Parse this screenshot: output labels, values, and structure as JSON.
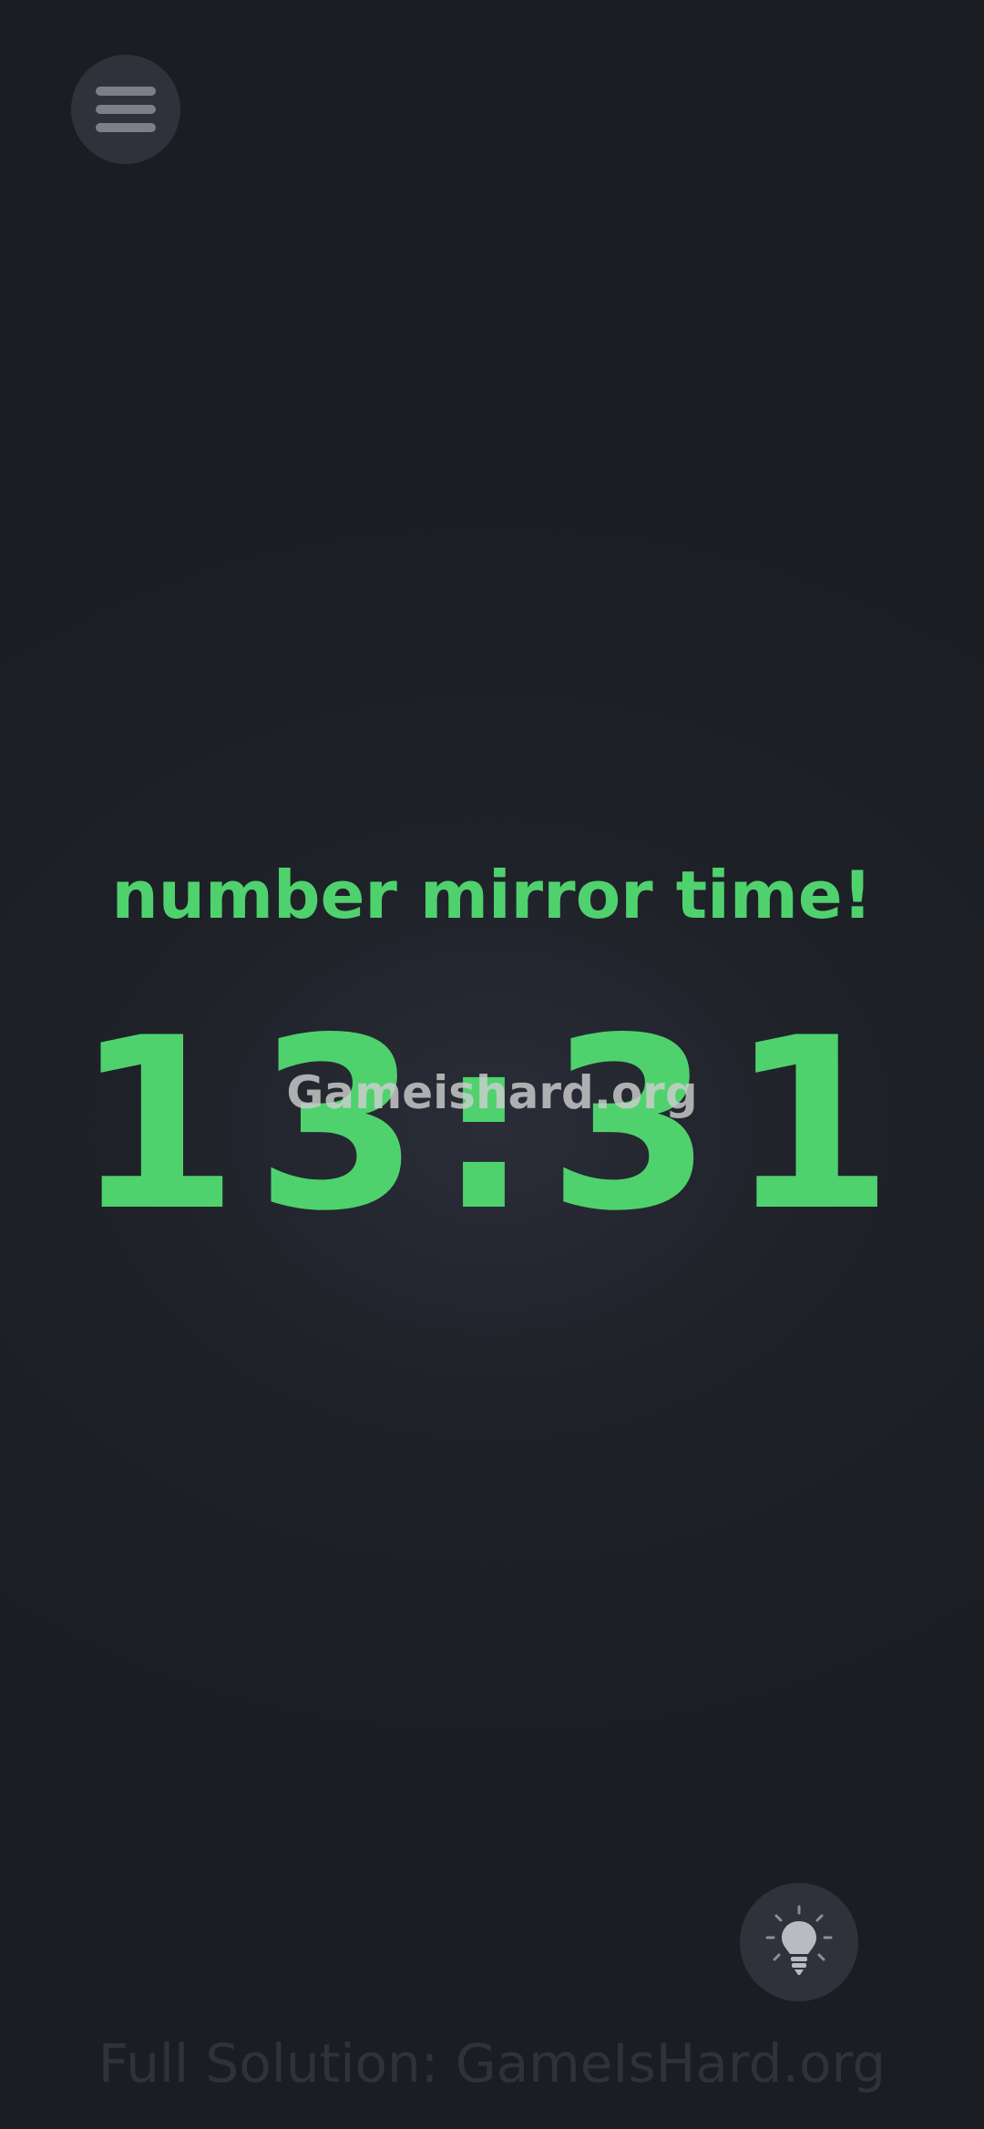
{
  "header": {
    "menu_icon": "hamburger-menu-icon"
  },
  "level": {
    "subtitle": "number mirror time!",
    "clock_time": "13:31"
  },
  "overlay": {
    "watermark": "Gameishard.org",
    "footer": "Full Solution: GameIsHard.org"
  },
  "controls": {
    "hint_icon": "lightbulb-icon"
  },
  "colors": {
    "accent": "#4fd26d",
    "background": "#1e2027",
    "button": "#2f323b"
  }
}
